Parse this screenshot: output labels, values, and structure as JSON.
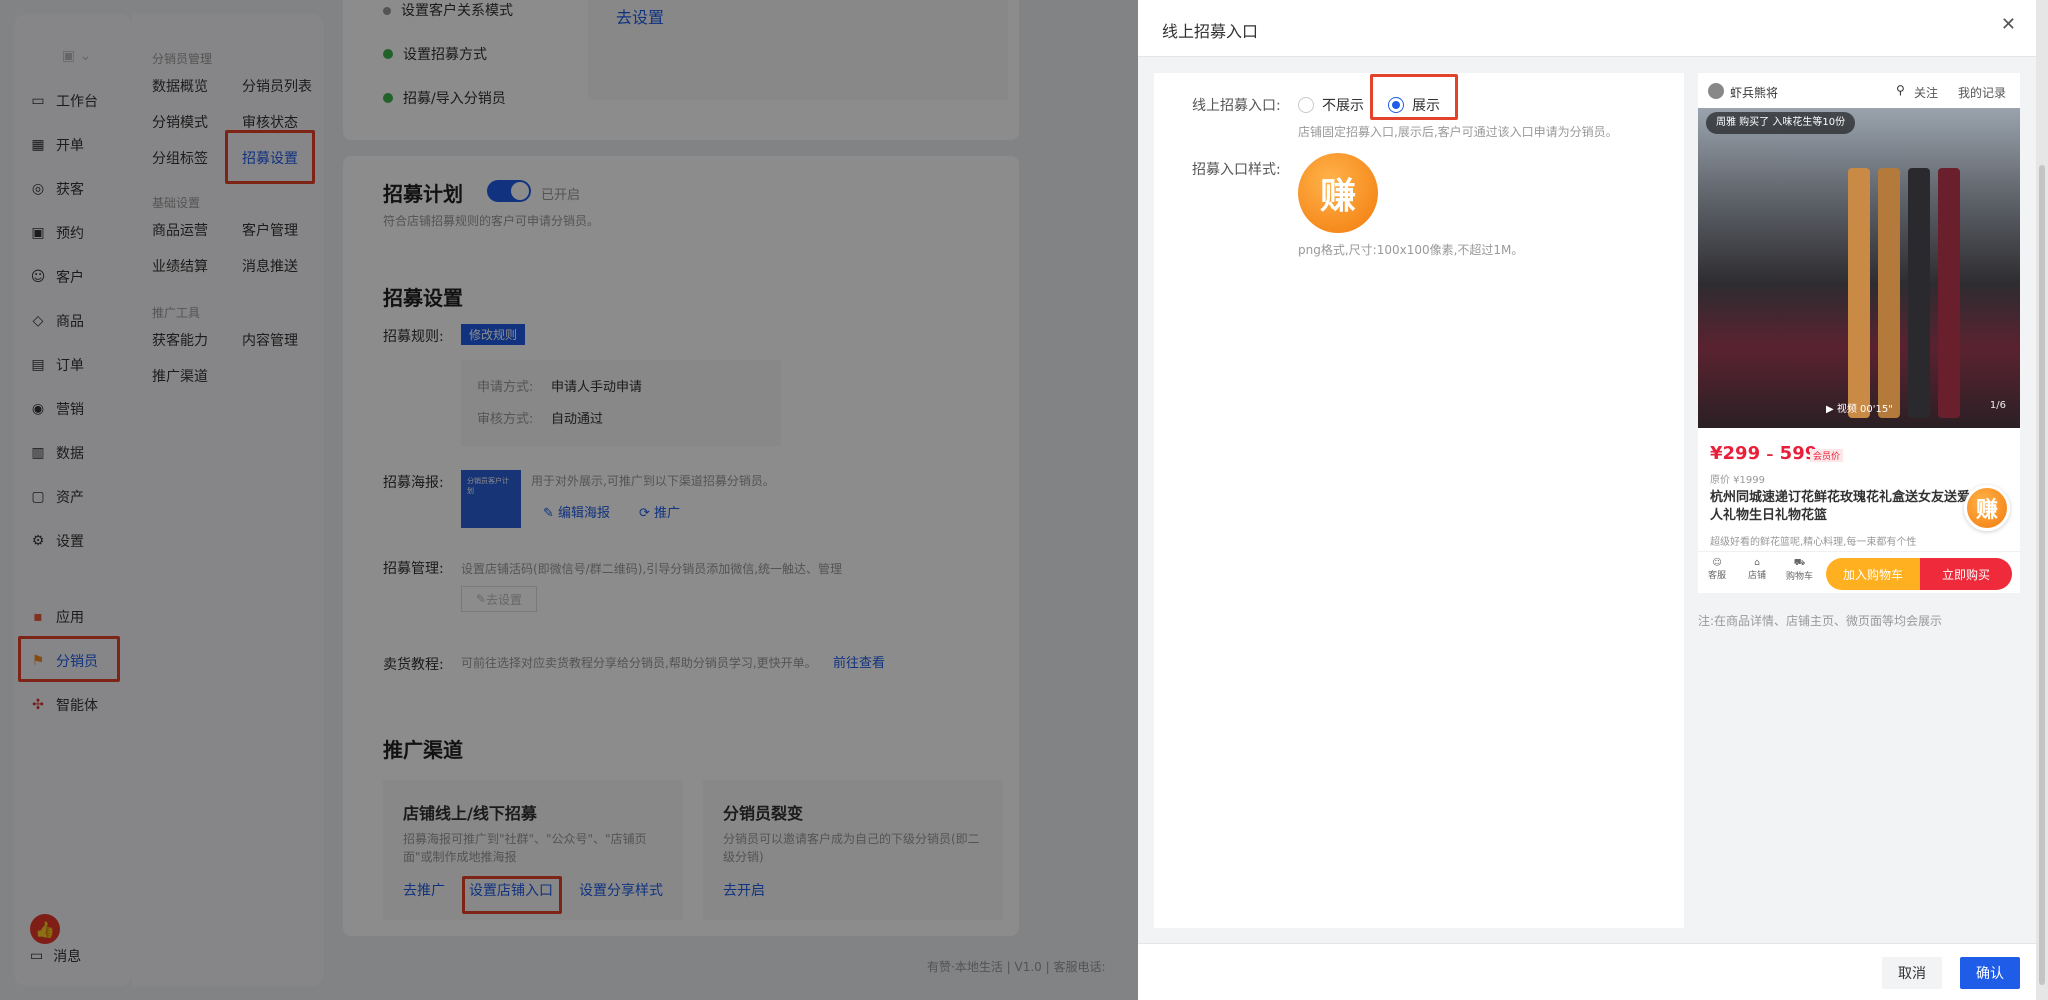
{
  "nav": {
    "items": [
      {
        "label": "工作台",
        "icon": "monitor-icon"
      },
      {
        "label": "开单",
        "icon": "cash-register-icon"
      },
      {
        "label": "获客",
        "icon": "magnet-icon"
      },
      {
        "label": "预约",
        "icon": "calendar-icon"
      },
      {
        "label": "客户",
        "icon": "user-icon"
      },
      {
        "label": "商品",
        "icon": "bag-icon"
      },
      {
        "label": "订单",
        "icon": "order-icon"
      },
      {
        "label": "营销",
        "icon": "target-icon"
      },
      {
        "label": "数据",
        "icon": "chart-icon"
      },
      {
        "label": "资产",
        "icon": "asset-icon"
      },
      {
        "label": "设置",
        "icon": "gear-icon"
      },
      {
        "label": "应用",
        "icon": "apps-icon"
      },
      {
        "label": "分销员",
        "icon": "distributor-icon"
      },
      {
        "label": "智能体",
        "icon": "agent-icon"
      }
    ],
    "message_label": "消息"
  },
  "subnav": {
    "group1": "分销员管理",
    "group1_items": [
      "数据概览",
      "分销员列表",
      "分销模式",
      "审核状态",
      "分组标签",
      "招募设置"
    ],
    "group2": "基础设置",
    "group2_items": [
      "商品运营",
      "客户管理",
      "业绩结算",
      "消息推送"
    ],
    "group3": "推广工具",
    "group3_items": [
      "获客能力",
      "内容管理",
      "推广渠道"
    ]
  },
  "steps": {
    "items": [
      "设置客户关系模式",
      "设置招募方式",
      "招募/导入分销员"
    ],
    "go_setting": "去设置"
  },
  "plan": {
    "title": "招募计划",
    "status": "已开启",
    "desc": "符合店铺招募规则的客户可申请分销员。"
  },
  "recruit": {
    "title": "招募设置",
    "rule_label": "招募规则:",
    "rule_btn": "修改规则",
    "apply_label": "申请方式:",
    "apply_value": "申请人手动申请",
    "review_label": "审核方式:",
    "review_value": "自动通过",
    "poster_label": "招募海报:",
    "poster_thumb_text": "分销员客户计划",
    "poster_desc": "用于对外展示,可推广到以下渠道招募分销员。",
    "edit_poster": "编辑海报",
    "promote": "推广",
    "manage_label": "招募管理:",
    "manage_desc": "设置店铺活码(即微信号/群二维码),引导分销员添加微信,统一触达、管理",
    "manage_btn": "去设置",
    "tutorial_label": "卖货教程:",
    "tutorial_desc": "可前往选择对应卖货教程分享给分销员,帮助分销员学习,更快开单。",
    "tutorial_link": "前往查看"
  },
  "channels": {
    "title": "推广渠道",
    "card1_title": "店铺线上/线下招募",
    "card1_desc": "招募海报可推广到\"社群\"、\"公众号\"、\"店铺页面\"或制作成地推海报",
    "card1_links": [
      "去推广",
      "设置店铺入口",
      "设置分享样式"
    ],
    "card2_title": "分销员裂变",
    "card2_desc": "分销员可以邀请客户成为自己的下级分销员(即二级分销)",
    "card2_link": "去开启"
  },
  "footer_text": "有赞·本地生活 | V1.0 | 客服电话:",
  "drawer": {
    "title": "线上招募入口",
    "entry_label": "线上招募入口:",
    "opt_hide": "不展示",
    "opt_show": "展示",
    "selected": "展示",
    "entry_hint": "店铺固定招募入口,展示后,客户可通过该入口申请为分销员。",
    "style_label": "招募入口样式:",
    "icon_text": "赚",
    "style_hint": "png格式,尺寸:100x100像素,不超过1M。",
    "note": "注:在商品详情、店铺主页、微页面等均会展示",
    "cancel": "取消",
    "confirm": "确认"
  },
  "preview": {
    "shop_name": "虾兵熊将",
    "follow": "关注",
    "records": "我的记录",
    "buyer_ticker": "周雅 购买了 入味花生等10份",
    "video_label": "视频 00'15\"",
    "page_indicator": "1/6",
    "price_low": "¥299",
    "price_sep": "–",
    "price_high": "599",
    "member_tag": "会员价",
    "orig_price": "原价 ¥1999",
    "product_title": "杭州同城速递订花鲜花玫瑰花礼盒送女友送爱人礼物生日礼物花篮",
    "product_sub": "超级好看的鲜花篮呢,精心料理,每一束都有个性",
    "tab_service": "客服",
    "tab_shop": "店铺",
    "tab_cart": "购物车",
    "add_cart": "加入购物车",
    "buy_now": "立即购买"
  },
  "colors": {
    "accent": "#1f5de8",
    "highlight": "#e3432b",
    "price": "#e8203a",
    "orange": "#f5a623"
  }
}
